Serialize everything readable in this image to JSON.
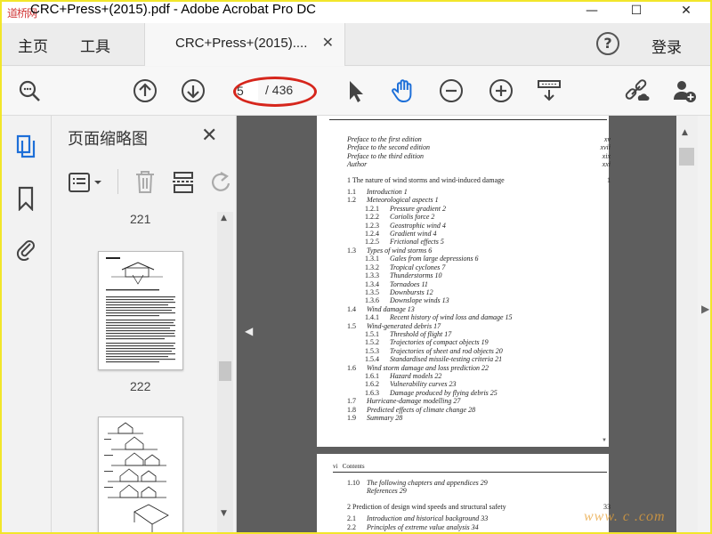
{
  "window": {
    "title": "CRC+Press+(2015).pdf - Adobe Acrobat Pro DC",
    "watermark_top": "道桥网",
    "minimize": "—",
    "maximize": "☐",
    "close": "✕"
  },
  "tabs": {
    "home": "主页",
    "tools": "工具",
    "document": "CRC+Press+(2015)....",
    "close": "✕",
    "help": "?",
    "signin": "登录"
  },
  "toolbar": {
    "page_current": "5",
    "page_total": "/ 436"
  },
  "thumbnails": {
    "title": "页面缩略图",
    "close": "✕",
    "labels": [
      "221",
      "222"
    ]
  },
  "document": {
    "page1": {
      "front": [
        {
          "title": "Preface to the first edition",
          "page": "xv"
        },
        {
          "title": "Preface to the second edition",
          "page": "xvii"
        },
        {
          "title": "Preface to the third edition",
          "page": "xix"
        },
        {
          "title": "Author",
          "page": "xxi"
        }
      ],
      "chapter": {
        "num": "1",
        "title": "The nature of wind storms and wind-induced damage",
        "page": "1"
      },
      "entries": [
        {
          "level": 1,
          "num": "1.1",
          "title": "Introduction  1"
        },
        {
          "level": 1,
          "num": "1.2",
          "title": "Meteorological aspects  1"
        },
        {
          "level": 2,
          "num": "1.2.1",
          "title": "Pressure gradient  2"
        },
        {
          "level": 2,
          "num": "1.2.2",
          "title": "Coriolis force  2"
        },
        {
          "level": 2,
          "num": "1.2.3",
          "title": "Geostrophic wind  4"
        },
        {
          "level": 2,
          "num": "1.2.4",
          "title": "Gradient wind  4"
        },
        {
          "level": 2,
          "num": "1.2.5",
          "title": "Frictional effects  5"
        },
        {
          "level": 1,
          "num": "1.3",
          "title": "Types of wind storms  6"
        },
        {
          "level": 2,
          "num": "1.3.1",
          "title": "Gales from large depressions  6"
        },
        {
          "level": 2,
          "num": "1.3.2",
          "title": "Tropical cyclones  7"
        },
        {
          "level": 2,
          "num": "1.3.3",
          "title": "Thunderstorms  10"
        },
        {
          "level": 2,
          "num": "1.3.4",
          "title": "Tornadoes  11"
        },
        {
          "level": 2,
          "num": "1.3.5",
          "title": "Downbursts  12"
        },
        {
          "level": 2,
          "num": "1.3.6",
          "title": "Downslope winds  13"
        },
        {
          "level": 1,
          "num": "1.4",
          "title": "Wind damage  13"
        },
        {
          "level": 2,
          "num": "1.4.1",
          "title": "Recent history of wind loss and damage  15"
        },
        {
          "level": 1,
          "num": "1.5",
          "title": "Wind-generated debris  17"
        },
        {
          "level": 2,
          "num": "1.5.1",
          "title": "Threshold of flight  17"
        },
        {
          "level": 2,
          "num": "1.5.2",
          "title": "Trajectories of compact objects  19"
        },
        {
          "level": 2,
          "num": "1.5.3",
          "title": "Trajectories of sheet and rod objects  20"
        },
        {
          "level": 2,
          "num": "1.5.4",
          "title": "Standardised missile-testing criteria  21"
        },
        {
          "level": 1,
          "num": "1.6",
          "title": "Wind storm damage and loss prediction  22"
        },
        {
          "level": 2,
          "num": "1.6.1",
          "title": "Hazard models  22"
        },
        {
          "level": 2,
          "num": "1.6.2",
          "title": "Vulnerability curves  23"
        },
        {
          "level": 2,
          "num": "1.6.3",
          "title": "Damage produced by flying debris  25"
        },
        {
          "level": 1,
          "num": "1.7",
          "title": "Hurricane-damage modelling  27"
        },
        {
          "level": 1,
          "num": "1.8",
          "title": "Predicted effects of climate change  28"
        },
        {
          "level": 1,
          "num": "1.9",
          "title": "Summary  28"
        }
      ]
    },
    "page2": {
      "header_num": "vi",
      "header_title": "Contents",
      "entries": [
        {
          "level": 1,
          "num": "1.10",
          "title": "The following chapters and appendices  29"
        },
        {
          "level": 1,
          "num": "",
          "title": "References  29"
        }
      ],
      "chapter": {
        "num": "2",
        "title": "Prediction of design wind speeds and structural safety",
        "page": "33"
      },
      "entries2": [
        {
          "level": 1,
          "num": "2.1",
          "title": "Introduction and historical background  33"
        },
        {
          "level": 1,
          "num": "2.2",
          "title": "Principles of extreme value analysis  34"
        }
      ]
    }
  },
  "watermark_bottom": "www. c    .com"
}
